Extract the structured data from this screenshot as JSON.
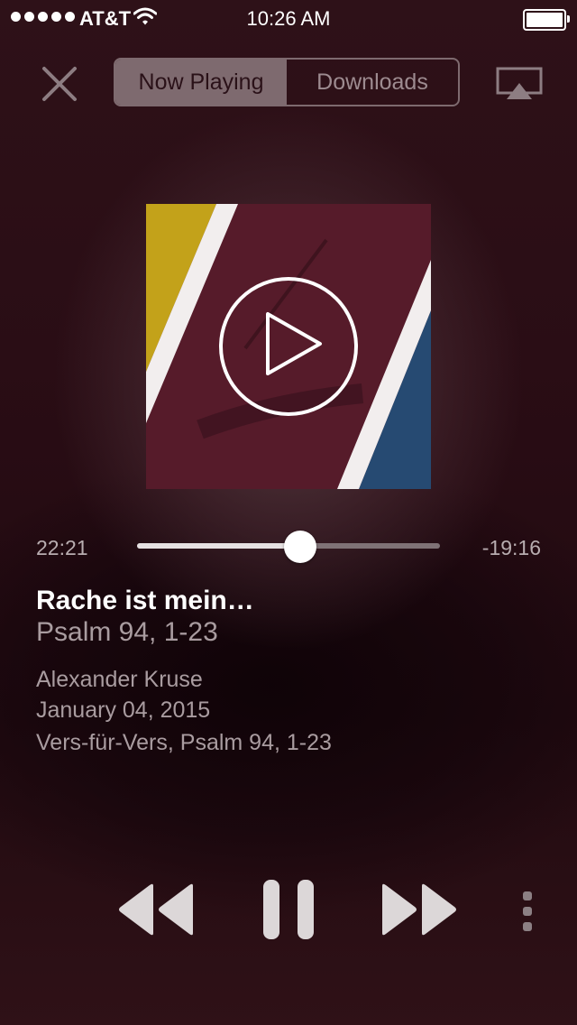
{
  "status_bar": {
    "carrier": "AT&T",
    "time": "10:26 AM",
    "signal_bars": 5,
    "battery_level": 1.0
  },
  "nav": {
    "tabs": [
      {
        "label": "Now Playing",
        "selected": true
      },
      {
        "label": "Downloads",
        "selected": false
      }
    ],
    "close_icon": "close-icon",
    "airplay_icon": "airplay-icon"
  },
  "player": {
    "elapsed": "22:21",
    "remaining": "-19:16",
    "progress": 0.54,
    "title": "Rache ist mein…",
    "subtitle": "Psalm 94, 1-23",
    "speaker": "Alexander Kruse",
    "date": "January 04, 2015",
    "series": "Vers-für-Vers, Psalm 94, 1-23",
    "artwork_play_icon": "play-icon"
  },
  "controls": {
    "rewind_icon": "rewind-icon",
    "pause_icon": "pause-icon",
    "fast_forward_icon": "fast-forward-icon",
    "more_icon": "more-icon"
  },
  "colors": {
    "background": "#2a0e15",
    "artwork_maroon": "#561b2a",
    "artwork_yellow": "#c3a21a",
    "artwork_blue": "#264a72",
    "accent_text": "#ffffff"
  }
}
